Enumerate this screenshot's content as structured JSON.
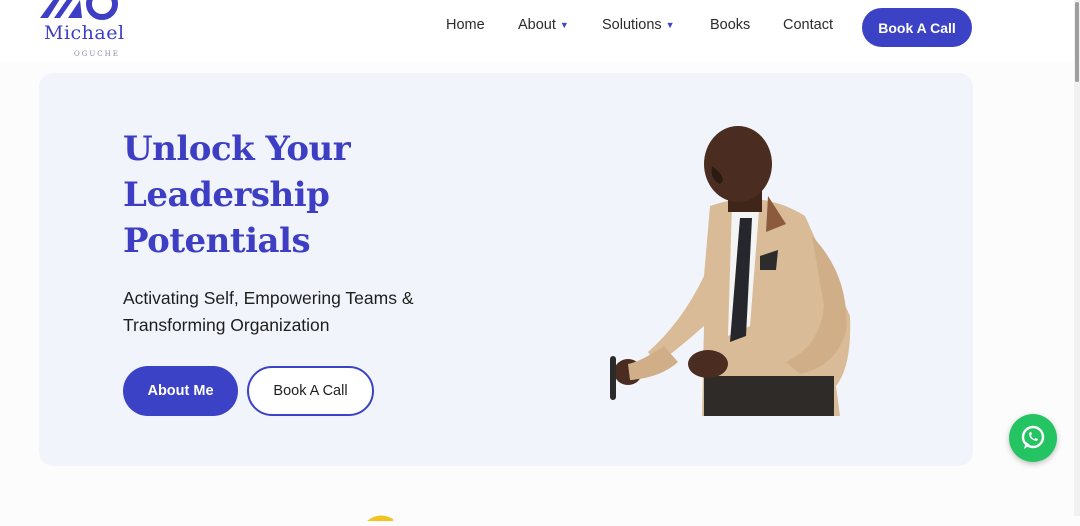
{
  "brand": {
    "name": "Michael",
    "surname": "OGUCHE",
    "color": "#3d3ec4"
  },
  "nav": {
    "items": [
      {
        "label": "Home",
        "has_dropdown": false
      },
      {
        "label": "About",
        "has_dropdown": true
      },
      {
        "label": "Solutions",
        "has_dropdown": true
      },
      {
        "label": "Books",
        "has_dropdown": false
      },
      {
        "label": "Contact",
        "has_dropdown": false
      }
    ],
    "dropdown_icon": "chevron-down-icon",
    "cta_label": "Book A Call"
  },
  "hero": {
    "headline": "Unlock Your Leadership Potentials",
    "subtitle": "Activating Self, Empowering Teams & Transforming Organization",
    "primary_button": "About Me",
    "secondary_button": "Book A Call",
    "image": "portrait of a speaker in beige suit holding a microphone"
  },
  "floating": {
    "icon": "whatsapp-icon",
    "color": "#25c463"
  },
  "colors": {
    "accent": "#3b42c6",
    "hero_background": "#f1f5fb",
    "text": "#1e1e1e"
  }
}
